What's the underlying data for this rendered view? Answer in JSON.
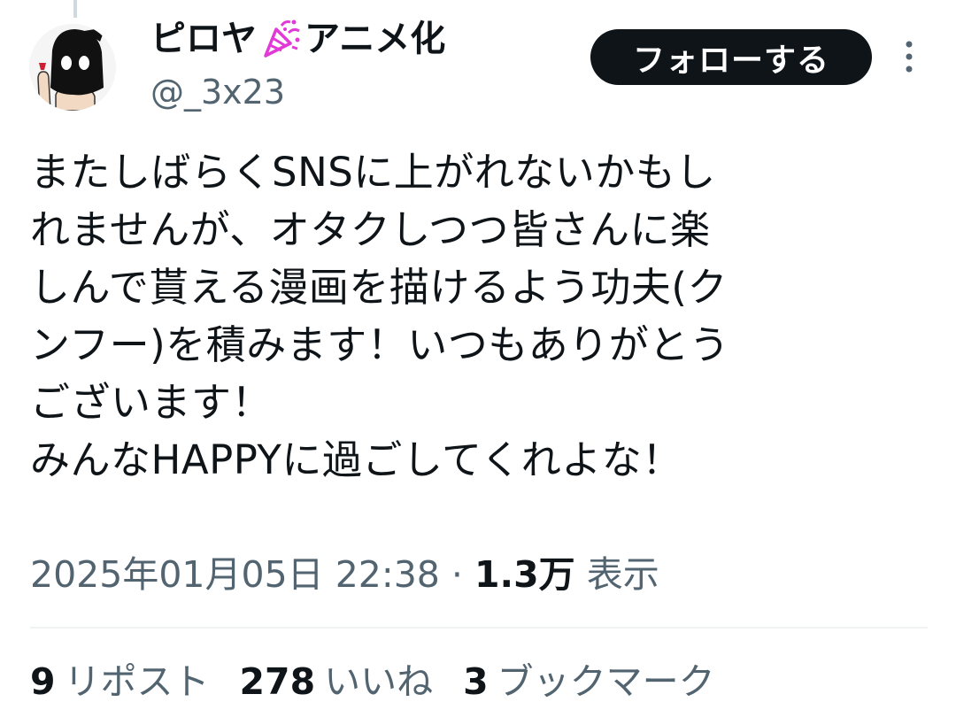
{
  "author": {
    "display_name_part1": "ピロヤ",
    "display_name_part2": "アニメ化",
    "name_emoji": "party-popper-icon",
    "handle": "@_3x23"
  },
  "follow_button_label": "フォローする",
  "tweet": {
    "lines": [
      "またしばらくSNSに上がれないかもし",
      "れませんが、オタクしつつ皆さんに楽",
      "しんで貰える漫画を描けるよう功夫(ク",
      "ンフー)を積みます！いつもありがとう",
      "ございます！",
      "みんなHAPPYに過ごしてくれよな！"
    ]
  },
  "meta": {
    "timestamp": "2025年01月05日 22:38",
    "separator": "·",
    "views_count": "1.3万",
    "views_label": "表示"
  },
  "stats": [
    {
      "count": "9",
      "label": "リポスト"
    },
    {
      "count": "278",
      "label": "いいね"
    },
    {
      "count": "3",
      "label": "ブックマーク"
    }
  ],
  "colors": {
    "text": "#0f1419",
    "secondary": "#536471",
    "button_bg": "#0f1419",
    "divider": "#eff3f4",
    "confetti": "#e23ad6"
  }
}
